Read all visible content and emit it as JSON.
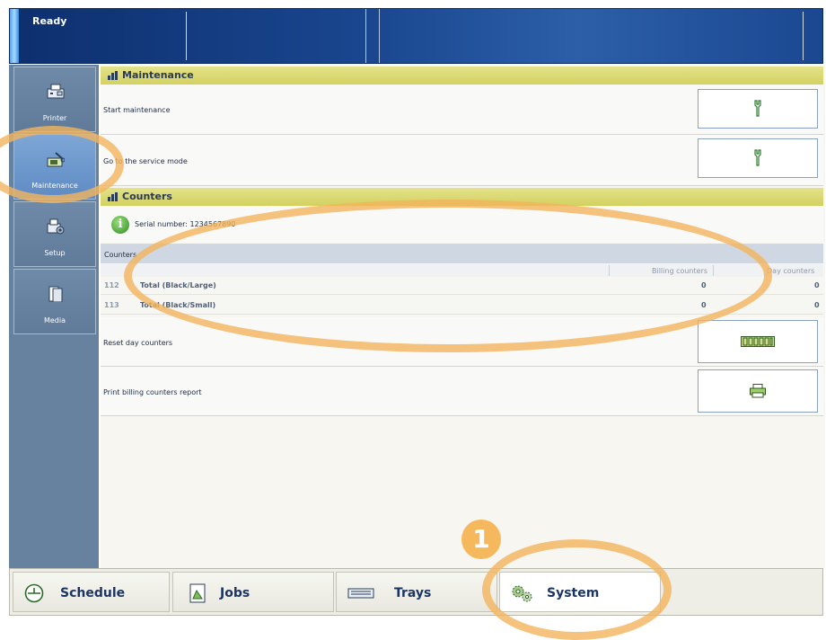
{
  "topbar": {
    "status": "Ready"
  },
  "sidebar": {
    "items": [
      {
        "label": "Printer",
        "icon": "printer-icon"
      },
      {
        "label": "Maintenance",
        "icon": "maintenance-icon"
      },
      {
        "label": "Setup",
        "icon": "setup-icon"
      },
      {
        "label": "Media",
        "icon": "media-icon"
      }
    ],
    "active": "Maintenance"
  },
  "maintenance": {
    "title": "Maintenance",
    "rows": [
      {
        "label": "Start maintenance",
        "button_icon": "wrench-icon"
      },
      {
        "label": "Go to the service mode",
        "button_icon": "wrench-icon"
      }
    ]
  },
  "counters": {
    "title": "Counters",
    "serial_label": "Serial number: 1234567890",
    "table_label": "Counters",
    "col_billing": "Billing counters",
    "col_day": "Day counters",
    "rows": [
      {
        "num": "112",
        "name": "Total (Black/Large)",
        "billing": "0",
        "day": "0"
      },
      {
        "num": "113",
        "name": "Total (Black/Small)",
        "billing": "0",
        "day": "0"
      }
    ],
    "reset_label": "Reset day counters",
    "reset_icon": "counter-digits-icon",
    "print_label": "Print billing counters report",
    "print_icon": "printer-icon"
  },
  "bottom_nav": {
    "items": [
      {
        "label": "Schedule",
        "icon": "clock-icon"
      },
      {
        "label": "Jobs",
        "icon": "document-icon"
      },
      {
        "label": "Trays",
        "icon": "tray-icon"
      },
      {
        "label": "System",
        "icon": "gears-icon"
      }
    ],
    "active": "System"
  },
  "callout": {
    "badge": "1"
  },
  "colors": {
    "accent_ring": "#f2b45c",
    "section_header": "#d9d86e",
    "sidebar": "#66829f"
  }
}
